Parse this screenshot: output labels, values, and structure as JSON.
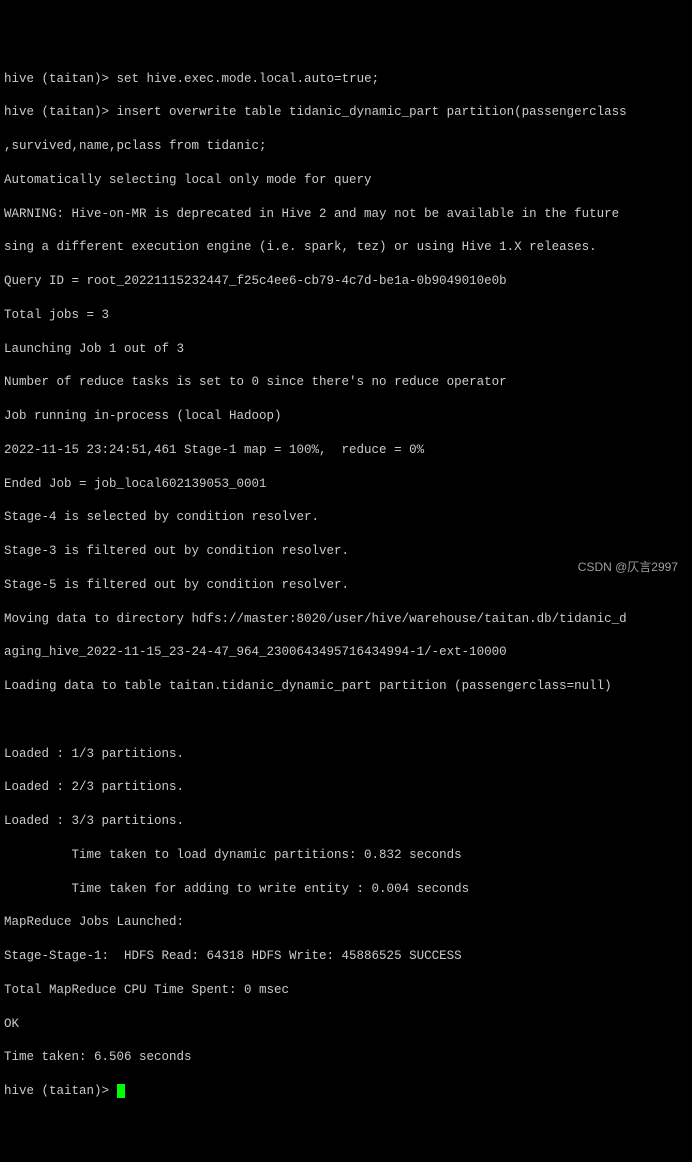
{
  "prompt1": "hive (taitan)> ",
  "cmd1": "set hive.exec.mode.local.auto=true;",
  "prompt2": "hive (taitan)> ",
  "cmd2a": "insert overwrite table tidanic_dynamic_part partition(passengerclass",
  "cmd2b": ",survived,name,pclass from tidanic;",
  "out": {
    "l1": "Automatically selecting local only mode for query",
    "l2": "WARNING: Hive-on-MR is deprecated in Hive 2 and may not be available in the future",
    "l3": "sing a different execution engine (i.e. spark, tez) or using Hive 1.X releases.",
    "l4": "Query ID = root_20221115232447_f25c4ee6-cb79-4c7d-be1a-0b9049010e0b",
    "l5": "Total jobs = 3",
    "l6": "Launching Job 1 out of 3",
    "l7": "Number of reduce tasks is set to 0 since there's no reduce operator",
    "l8": "Job running in-process (local Hadoop)",
    "l9": "2022-11-15 23:24:51,461 Stage-1 map = 100%,  reduce = 0%",
    "l10": "Ended Job = job_local602139053_0001",
    "l11": "Stage-4 is selected by condition resolver.",
    "l12": "Stage-3 is filtered out by condition resolver.",
    "l13": "Stage-5 is filtered out by condition resolver.",
    "l14": "Moving data to directory hdfs://master:8020/user/hive/warehouse/taitan.db/tidanic_d",
    "l15": "aging_hive_2022-11-15_23-24-47_964_2300643495716434994-1/-ext-10000",
    "l16": "Loading data to table taitan.tidanic_dynamic_part partition (passengerclass=null) ",
    "blank1": "",
    "blank2": "",
    "l17": "Loaded : 1/3 partitions.",
    "l18": "Loaded : 2/3 partitions.",
    "l19": "Loaded : 3/3 partitions.",
    "l20": "         Time taken to load dynamic partitions: 0.832 seconds",
    "l21": "         Time taken for adding to write entity : 0.004 seconds",
    "l22": "MapReduce Jobs Launched:",
    "l23": "Stage-Stage-1:  HDFS Read: 64318 HDFS Write: 45886525 SUCCESS",
    "l24": "Total MapReduce CPU Time Spent: 0 msec",
    "l25": "OK",
    "l26": "Time taken: 6.506 seconds"
  },
  "prompt3": "hive (taitan)> ",
  "watermark": "CSDN @仄言2997"
}
